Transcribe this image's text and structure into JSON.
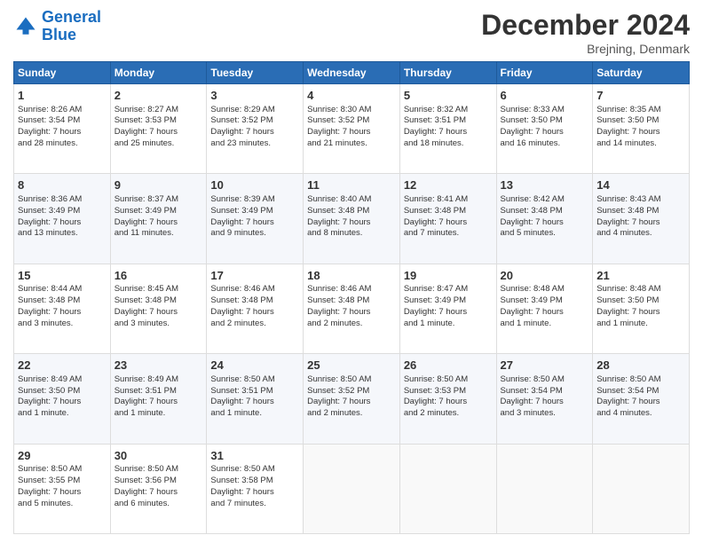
{
  "header": {
    "logo_line1": "General",
    "logo_line2": "Blue",
    "title": "December 2024",
    "location": "Brejning, Denmark"
  },
  "columns": [
    "Sunday",
    "Monday",
    "Tuesday",
    "Wednesday",
    "Thursday",
    "Friday",
    "Saturday"
  ],
  "weeks": [
    [
      {
        "day": "1",
        "lines": [
          "Sunrise: 8:26 AM",
          "Sunset: 3:54 PM",
          "Daylight: 7 hours",
          "and 28 minutes."
        ]
      },
      {
        "day": "2",
        "lines": [
          "Sunrise: 8:27 AM",
          "Sunset: 3:53 PM",
          "Daylight: 7 hours",
          "and 25 minutes."
        ]
      },
      {
        "day": "3",
        "lines": [
          "Sunrise: 8:29 AM",
          "Sunset: 3:52 PM",
          "Daylight: 7 hours",
          "and 23 minutes."
        ]
      },
      {
        "day": "4",
        "lines": [
          "Sunrise: 8:30 AM",
          "Sunset: 3:52 PM",
          "Daylight: 7 hours",
          "and 21 minutes."
        ]
      },
      {
        "day": "5",
        "lines": [
          "Sunrise: 8:32 AM",
          "Sunset: 3:51 PM",
          "Daylight: 7 hours",
          "and 18 minutes."
        ]
      },
      {
        "day": "6",
        "lines": [
          "Sunrise: 8:33 AM",
          "Sunset: 3:50 PM",
          "Daylight: 7 hours",
          "and 16 minutes."
        ]
      },
      {
        "day": "7",
        "lines": [
          "Sunrise: 8:35 AM",
          "Sunset: 3:50 PM",
          "Daylight: 7 hours",
          "and 14 minutes."
        ]
      }
    ],
    [
      {
        "day": "8",
        "lines": [
          "Sunrise: 8:36 AM",
          "Sunset: 3:49 PM",
          "Daylight: 7 hours",
          "and 13 minutes."
        ]
      },
      {
        "day": "9",
        "lines": [
          "Sunrise: 8:37 AM",
          "Sunset: 3:49 PM",
          "Daylight: 7 hours",
          "and 11 minutes."
        ]
      },
      {
        "day": "10",
        "lines": [
          "Sunrise: 8:39 AM",
          "Sunset: 3:49 PM",
          "Daylight: 7 hours",
          "and 9 minutes."
        ]
      },
      {
        "day": "11",
        "lines": [
          "Sunrise: 8:40 AM",
          "Sunset: 3:48 PM",
          "Daylight: 7 hours",
          "and 8 minutes."
        ]
      },
      {
        "day": "12",
        "lines": [
          "Sunrise: 8:41 AM",
          "Sunset: 3:48 PM",
          "Daylight: 7 hours",
          "and 7 minutes."
        ]
      },
      {
        "day": "13",
        "lines": [
          "Sunrise: 8:42 AM",
          "Sunset: 3:48 PM",
          "Daylight: 7 hours",
          "and 5 minutes."
        ]
      },
      {
        "day": "14",
        "lines": [
          "Sunrise: 8:43 AM",
          "Sunset: 3:48 PM",
          "Daylight: 7 hours",
          "and 4 minutes."
        ]
      }
    ],
    [
      {
        "day": "15",
        "lines": [
          "Sunrise: 8:44 AM",
          "Sunset: 3:48 PM",
          "Daylight: 7 hours",
          "and 3 minutes."
        ]
      },
      {
        "day": "16",
        "lines": [
          "Sunrise: 8:45 AM",
          "Sunset: 3:48 PM",
          "Daylight: 7 hours",
          "and 3 minutes."
        ]
      },
      {
        "day": "17",
        "lines": [
          "Sunrise: 8:46 AM",
          "Sunset: 3:48 PM",
          "Daylight: 7 hours",
          "and 2 minutes."
        ]
      },
      {
        "day": "18",
        "lines": [
          "Sunrise: 8:46 AM",
          "Sunset: 3:48 PM",
          "Daylight: 7 hours",
          "and 2 minutes."
        ]
      },
      {
        "day": "19",
        "lines": [
          "Sunrise: 8:47 AM",
          "Sunset: 3:49 PM",
          "Daylight: 7 hours",
          "and 1 minute."
        ]
      },
      {
        "day": "20",
        "lines": [
          "Sunrise: 8:48 AM",
          "Sunset: 3:49 PM",
          "Daylight: 7 hours",
          "and 1 minute."
        ]
      },
      {
        "day": "21",
        "lines": [
          "Sunrise: 8:48 AM",
          "Sunset: 3:50 PM",
          "Daylight: 7 hours",
          "and 1 minute."
        ]
      }
    ],
    [
      {
        "day": "22",
        "lines": [
          "Sunrise: 8:49 AM",
          "Sunset: 3:50 PM",
          "Daylight: 7 hours",
          "and 1 minute."
        ]
      },
      {
        "day": "23",
        "lines": [
          "Sunrise: 8:49 AM",
          "Sunset: 3:51 PM",
          "Daylight: 7 hours",
          "and 1 minute."
        ]
      },
      {
        "day": "24",
        "lines": [
          "Sunrise: 8:50 AM",
          "Sunset: 3:51 PM",
          "Daylight: 7 hours",
          "and 1 minute."
        ]
      },
      {
        "day": "25",
        "lines": [
          "Sunrise: 8:50 AM",
          "Sunset: 3:52 PM",
          "Daylight: 7 hours",
          "and 2 minutes."
        ]
      },
      {
        "day": "26",
        "lines": [
          "Sunrise: 8:50 AM",
          "Sunset: 3:53 PM",
          "Daylight: 7 hours",
          "and 2 minutes."
        ]
      },
      {
        "day": "27",
        "lines": [
          "Sunrise: 8:50 AM",
          "Sunset: 3:54 PM",
          "Daylight: 7 hours",
          "and 3 minutes."
        ]
      },
      {
        "day": "28",
        "lines": [
          "Sunrise: 8:50 AM",
          "Sunset: 3:54 PM",
          "Daylight: 7 hours",
          "and 4 minutes."
        ]
      }
    ],
    [
      {
        "day": "29",
        "lines": [
          "Sunrise: 8:50 AM",
          "Sunset: 3:55 PM",
          "Daylight: 7 hours",
          "and 5 minutes."
        ]
      },
      {
        "day": "30",
        "lines": [
          "Sunrise: 8:50 AM",
          "Sunset: 3:56 PM",
          "Daylight: 7 hours",
          "and 6 minutes."
        ]
      },
      {
        "day": "31",
        "lines": [
          "Sunrise: 8:50 AM",
          "Sunset: 3:58 PM",
          "Daylight: 7 hours",
          "and 7 minutes."
        ]
      },
      null,
      null,
      null,
      null
    ]
  ]
}
